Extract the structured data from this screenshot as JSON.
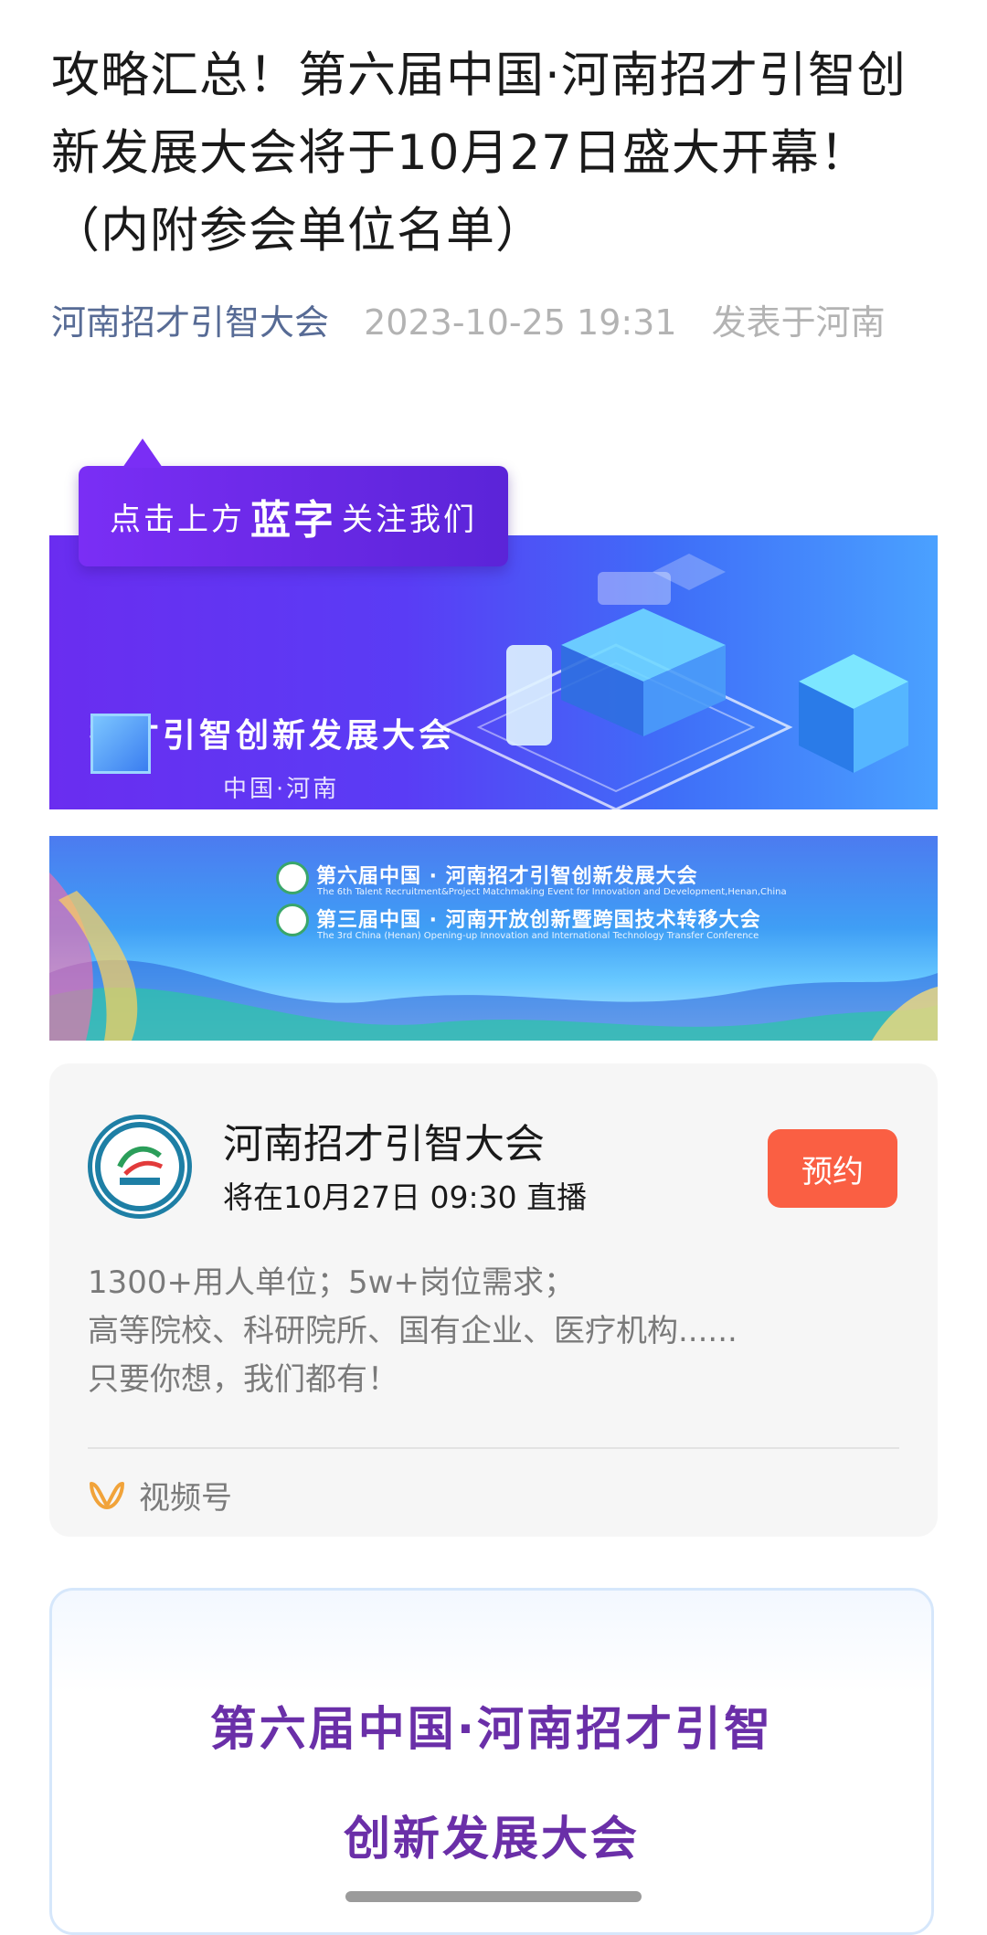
{
  "article": {
    "title": "攻略汇总！第六届中国·河南招才引智创新发展大会将于10月27日盛大开幕！（内附参会单位名单）",
    "account": "河南招才引智大会",
    "date": "2023-10-25 19:31",
    "location": "发表于河南"
  },
  "banner1": {
    "follow_pre": "点击上方",
    "follow_blue": "蓝字",
    "follow_post": "关注我们",
    "headline": "招才引智创新发展大会",
    "sub": "中国·河南"
  },
  "banner2": {
    "line1": "第六届中国 · 河南招才引智创新发展大会",
    "line1_en": "The 6th Talent Recruitment&Project Matchmaking Event for Innovation and Development,Henan,China",
    "line2": "第三届中国 · 河南开放创新暨跨国技术转移大会",
    "line2_en": "The 3rd China (Henan) Opening-up Innovation and International Technology Transfer Conference"
  },
  "live_card": {
    "name": "河南招才引智大会",
    "time": "将在10月27日 09:30 直播",
    "reserve_label": "预约",
    "desc": [
      "1300+用人单位；5w+岗位需求；",
      "高等院校、科研院所、国有企业、医疗机构......",
      "只要你想，我们都有！"
    ],
    "channel_label": "视频号"
  },
  "intro": {
    "line1": "第六届中国·河南招才引智",
    "line2": "创新发展大会"
  },
  "colors": {
    "account_link": "#576b95",
    "reserve_button": "#fa5f43",
    "intro_title": "#6a2fa8"
  }
}
